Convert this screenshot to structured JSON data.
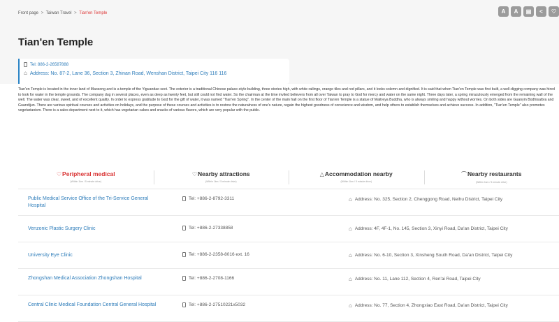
{
  "breadcrumb": {
    "home": "Front page",
    "section": "Taiwan Travel",
    "current": "Tian'en Temple",
    "sep": ">"
  },
  "toolbar": [
    {
      "glyph": "A",
      "icon": "font-decrease-icon"
    },
    {
      "glyph": "A",
      "icon": "font-increase-icon"
    },
    {
      "glyph": "▤",
      "icon": "print-icon"
    },
    {
      "glyph": "<",
      "icon": "share-icon"
    },
    {
      "glyph": "♡",
      "icon": "favorite-icon"
    }
  ],
  "title": "Tian'en Temple",
  "contact": {
    "tel": "Tel: 886-2-26587888",
    "address": "Address: No. 87-2, Lane 36, Section 3, Zhinan Road, Wenshan District, Taipei City 116 116"
  },
  "description": "Tian'en Temple is located in the inner land of Maosong and is a temple of the Yiguandao sect. The exterior is a traditional Chinese palace-style building, three stories high, with white railings, orange tiles and red pillars, and it looks solemn and dignified. It is said that when Tian'en Temple was first built, a well-digging company was hired to look for water in the temple grounds. The company dug in several places, even as deep as twenty feet, but still could not find water. So the chairman at the time invited believers from all over Taiwan to pray to God for mercy and water on the same night. Three days later, a spring miraculously emerged from the remaining wall of the well. The water was clear, sweet, and of excellent quality. In order to express gratitude to God for the gift of water, it was named \"Tian'en Spring\". In the center of the main hall on the first floor of Tian'en Temple is a statue of Maitreya Buddha, who is always smiling and happy without worries. On both sides are Guanyin Bodhisattva and Guandijun. There are various spiritual courses and activities on holidays, and the purpose of these courses and activities is to restore the naturalness of one's nature, regain the highest goodness of conscience and wisdom, and help others to establish themselves and achieve success. In addition, \"Tian'en Temple\" also promotes vegetarianism. There is a sales department next to it, which has vegetarian cakes and snacks of various flavors, which are very popular with the public.",
  "tabs": [
    {
      "label": "Peripheral medical",
      "glyph": "♡",
      "icon": "medical-icon",
      "sub": "(Within 1km / 5 minute drive)",
      "active": true
    },
    {
      "label": "Nearby attractions",
      "glyph": "♡",
      "icon": "attraction-icon",
      "sub": "(Within 1km / 5 minute drive)",
      "active": false
    },
    {
      "label": "Accommodation nearby",
      "glyph": "△",
      "icon": "accommodation-icon",
      "sub": "(Within 1km / 5 minute drive)",
      "active": false
    },
    {
      "label": "Nearby restaurants",
      "glyph": "⌒",
      "icon": "restaurant-icon",
      "sub": "(Within 1km / 5 minute drive)",
      "active": false
    }
  ],
  "places": [
    {
      "name": "Public Medical Service Office of the Tri-Service General Hospital",
      "tel": "Tel: +886-2-8792-3311",
      "address": "Address: No. 325, Section 2, Chenggong Road, Neihu District, Taipei City"
    },
    {
      "name": "Venzonic Plastic Surgery Clinic",
      "tel": "Tel: +886-2-27338858",
      "address": "Address: 4F, 4F-1, No. 145, Section 3, Xinyi Road, Da'an District, Taipei City"
    },
    {
      "name": "University Eye Clinic",
      "tel": "Tel: +886-2-2358-8016 ext. 16",
      "address": "Address: No. 6-10, Section 3, Xinsheng South Road, Da'an District, Taipei City"
    },
    {
      "name": "Zhongshan Medical Association Zhongshan Hospital",
      "tel": "Tel: +886-2-2708-1166",
      "address": "Address: No. 11, Lane 112, Section 4, Ren'ai Road, Taipei City"
    },
    {
      "name": "Central Clinic Medical Foundation Central General Hospital",
      "tel": "Tel: +886-2-27510221x5032",
      "address": "Address: No. 77, Section 4, Zhongxiao East Road, Da'an District, Taipei City"
    }
  ]
}
